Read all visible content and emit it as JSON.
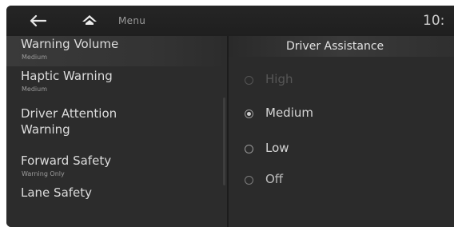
{
  "topbar": {
    "back_icon": "back-arrow-icon",
    "home_icon": "home-icon",
    "menu_label": "Menu",
    "clock": "10:"
  },
  "left_menu": {
    "items": [
      {
        "title": "Warning Volume",
        "subtitle": "Medium",
        "selected": true
      },
      {
        "title": "Haptic Warning",
        "subtitle": "Medium"
      },
      {
        "title": "Driver Attention",
        "title_line2": "Warning"
      },
      {
        "title": "Forward Safety",
        "subtitle": "Warning Only"
      },
      {
        "title": "Lane Safety"
      }
    ]
  },
  "right_panel": {
    "title": "Driver Assistance",
    "options": [
      {
        "label": "High",
        "state": "disabled",
        "checked": false
      },
      {
        "label": "Medium",
        "state": "enabled",
        "checked": true
      },
      {
        "label": "Low",
        "state": "enabled",
        "checked": false
      },
      {
        "label": "Off",
        "state": "dim",
        "checked": false
      }
    ]
  },
  "colors": {
    "background": "#2a2a2a",
    "text": "#dcdcdc",
    "disabled_text": "#575757"
  }
}
